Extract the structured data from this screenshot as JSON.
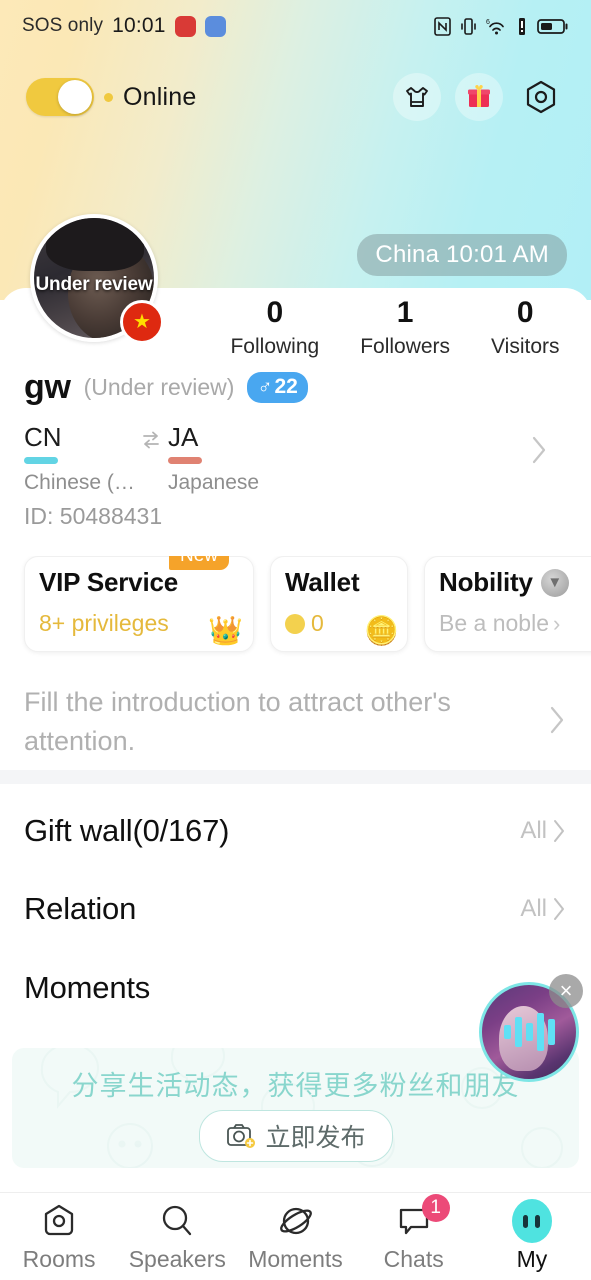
{
  "statusbar": {
    "carrier": "SOS only",
    "time": "10:01",
    "app_icons": [
      "red-app-icon",
      "blue-app-icon"
    ],
    "right_icons": [
      "nfc-icon",
      "vibrate-icon",
      "wifi-icon",
      "signal-alert-icon",
      "battery-icon"
    ]
  },
  "topbar": {
    "online_label": "Online",
    "toggle_state": "on",
    "icons": [
      {
        "name": "dress-up-icon"
      },
      {
        "name": "gift-icon"
      },
      {
        "name": "settings-icon"
      }
    ]
  },
  "profile": {
    "location_time": "China 10:01 AM",
    "avatar_overlay": "Under review",
    "avatar_flag": "china-flag-badge",
    "name": "gw",
    "review_tag": "(Under review)",
    "gender_symbol": "♂",
    "age": "22",
    "user_id": "ID: 50488431",
    "stats": [
      {
        "value": "0",
        "label": "Following"
      },
      {
        "value": "1",
        "label": "Followers"
      },
      {
        "value": "0",
        "label": "Visitors"
      }
    ],
    "language": {
      "from_code": "CN",
      "from_name": "Chinese (…",
      "to_code": "JA",
      "to_name": "Japanese",
      "swap_icon": "swap-icon",
      "from_color": "#62d4e4",
      "to_color": "#e08272"
    }
  },
  "cards": [
    {
      "id": "vip",
      "title": "VIP Service",
      "subtitle": "8+ privileges",
      "badge": "New",
      "icon": "crown-icon"
    },
    {
      "id": "wallet",
      "title": "Wallet",
      "subtitle": "0",
      "icon": "coin-icon"
    },
    {
      "id": "nobility",
      "title": "Nobility",
      "subtitle": "Be a noble",
      "icon": "noble-medal-icon"
    }
  ],
  "intro": {
    "text": "Fill the introduction to attract other's attention."
  },
  "sections": [
    {
      "title": "Gift wall(0/167)",
      "action": "All"
    },
    {
      "title": "Relation",
      "action": "All"
    },
    {
      "title": "Moments",
      "action": ""
    }
  ],
  "promo": {
    "text": "分享生活动态，获得更多粉丝和朋友",
    "button_label": "立即发布",
    "button_icon": "camera-add-icon"
  },
  "float_bubble": {
    "close_label": "×",
    "waveform_bars": [
      14,
      30,
      18,
      38,
      26
    ],
    "ring_color": "#7ee6e6"
  },
  "bottom_nav": [
    {
      "label": "Rooms",
      "icon": "rooms-icon",
      "active": false,
      "badge": ""
    },
    {
      "label": "Speakers",
      "icon": "search-icon",
      "active": false,
      "badge": ""
    },
    {
      "label": "Moments",
      "icon": "planet-icon",
      "active": false,
      "badge": ""
    },
    {
      "label": "Chats",
      "icon": "chat-bubble-icon",
      "active": false,
      "badge": "1"
    },
    {
      "label": "My",
      "icon": "my-face-icon",
      "active": true,
      "badge": ""
    }
  ],
  "colors": {
    "accent_yellow": "#f0c93f",
    "accent_cyan": "#4fe3e0",
    "badge_pink": "#ec4a78",
    "badge_orange": "#f5a32a",
    "gender_blue": "#49a7f0"
  }
}
